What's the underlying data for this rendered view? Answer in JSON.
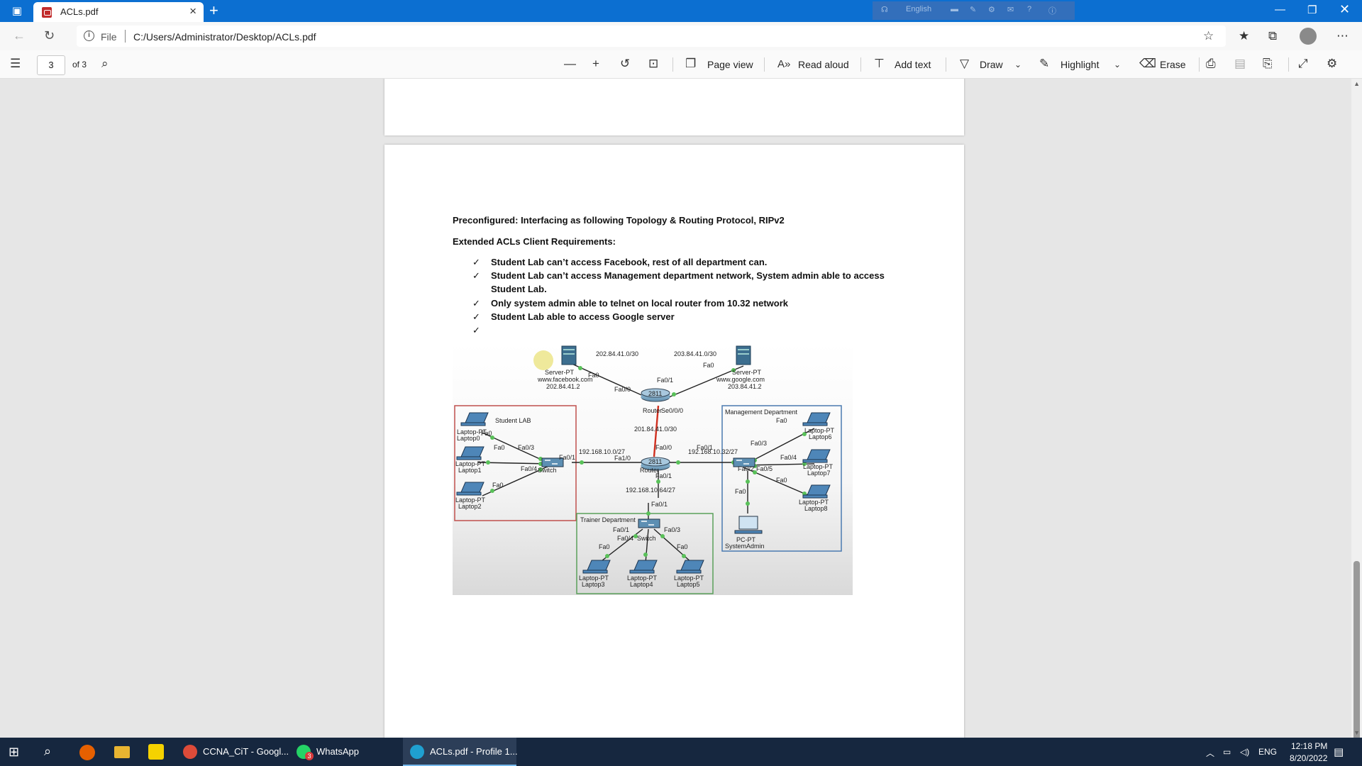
{
  "browser": {
    "tab_title": "ACLs.pdf",
    "new_tab": "+",
    "address": {
      "scheme_label": "File",
      "url": "C:/Users/Administrator/Desktop/ACLs.pdf"
    },
    "lang_indicator": "English"
  },
  "pdf_toolbar": {
    "page_number": "3",
    "page_total": "of 3",
    "page_view": "Page view",
    "read_aloud": "Read aloud",
    "add_text": "Add text",
    "draw": "Draw",
    "highlight": "Highlight",
    "erase": "Erase"
  },
  "document": {
    "preconfigured": "Preconfigured: Interfacing as following Topology & Routing Protocol, RIPv2",
    "requirements_title": "Extended ACLs Client Requirements:",
    "check_mark": "✓",
    "requirements": [
      "Student Lab can’t access Facebook, rest of all department can.",
      "Student Lab can’t access Management department network, System admin able to access",
      "Student Lab.",
      "Only system admin able to telnet on local router from 10.32 network",
      "Student Lab able to access Google server"
    ]
  },
  "topology": {
    "links": {
      "left_top": "202.84.41.0/30",
      "right_top": "203.84.41.0/30",
      "serial": "201.84.41.0/30",
      "student": "192.168.10.0/27",
      "mgmt": "192.168.10.32/27",
      "trainer": "192.168.10.64/27"
    },
    "servers": {
      "facebook_name": "Server-PT",
      "facebook_url": "www.facebook.com",
      "facebook_ip": "202.84.41.2",
      "google_name": "Server-PT",
      "google_url": "www.google.com",
      "google_ip": "203.84.41.2"
    },
    "routers": {
      "top_model": "2811",
      "top_name": "Router",
      "mid_model": "2811",
      "mid_name": "Router"
    },
    "ports": {
      "fa0": "Fa0",
      "fa0_0": "Fa0/0",
      "fa0_1": "Fa0/1",
      "fa0_2": "Fa0/2",
      "fa0_3": "Fa0/3",
      "fa0_4": "Fa0/4",
      "fa0_5": "Fa0/5",
      "fa1_0": "Fa1/0",
      "se0_0_0": "Se0/0/0"
    },
    "areas": {
      "student": "Student LAB",
      "management": "Management Department",
      "trainer": "Trainer Department"
    },
    "device_type": "Laptop-PT",
    "switch_name": "Switch",
    "laptops": [
      "Laptop0",
      "Laptop1",
      "Laptop2",
      "Laptop3",
      "Laptop4",
      "Laptop5",
      "Laptop6",
      "Laptop7",
      "Laptop8"
    ],
    "pc_type": "PC-PT",
    "pc_name": "SystemAdmin"
  },
  "taskbar": {
    "apps": [
      {
        "label": "CCNA_CiT - Googl..."
      },
      {
        "label": "WhatsApp",
        "badge": "3"
      },
      {
        "label": "ACLs.pdf - Profile 1..."
      }
    ],
    "language": "ENG",
    "time": "12:18 PM",
    "date": "8/20/2022"
  },
  "colors": {
    "titlebar": "#0c6fd1",
    "taskbar": "#16273f",
    "student_box": "#c0504d",
    "management_box": "#4a7ab0",
    "trainer_box": "#5aa05a",
    "serial_link": "#d03020"
  }
}
